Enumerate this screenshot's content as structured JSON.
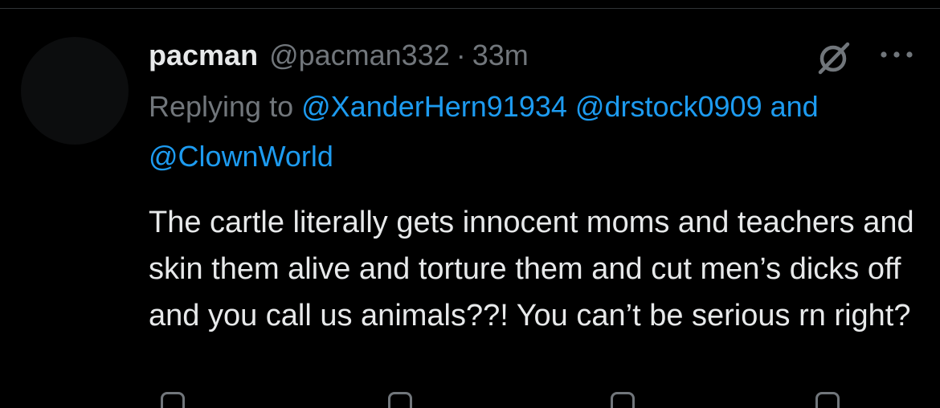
{
  "tweet": {
    "display_name": "pacman",
    "handle": "@pacman332",
    "separator": "·",
    "time": "33m",
    "replying_prefix": "Replying to",
    "mention_1": "@XanderHern91934",
    "mention_2": "@drstock0909",
    "and_word": "and",
    "mention_3": "@ClownWorld",
    "text": "The cartle literally gets innocent moms and teachers and skin them alive and torture them and cut men’s dicks off and you call us animals??! You can’t be serious rn right?"
  },
  "icons": {
    "grok": "grok-icon",
    "more": "more-icon",
    "reply": "reply-icon",
    "retweet": "retweet-icon",
    "like": "like-icon",
    "share": "share-icon"
  },
  "colors": {
    "background": "#000000",
    "primary_text": "#e7e9ea",
    "secondary_text": "#71767b",
    "mention": "#1d9bf0",
    "divider": "#2f3336"
  }
}
